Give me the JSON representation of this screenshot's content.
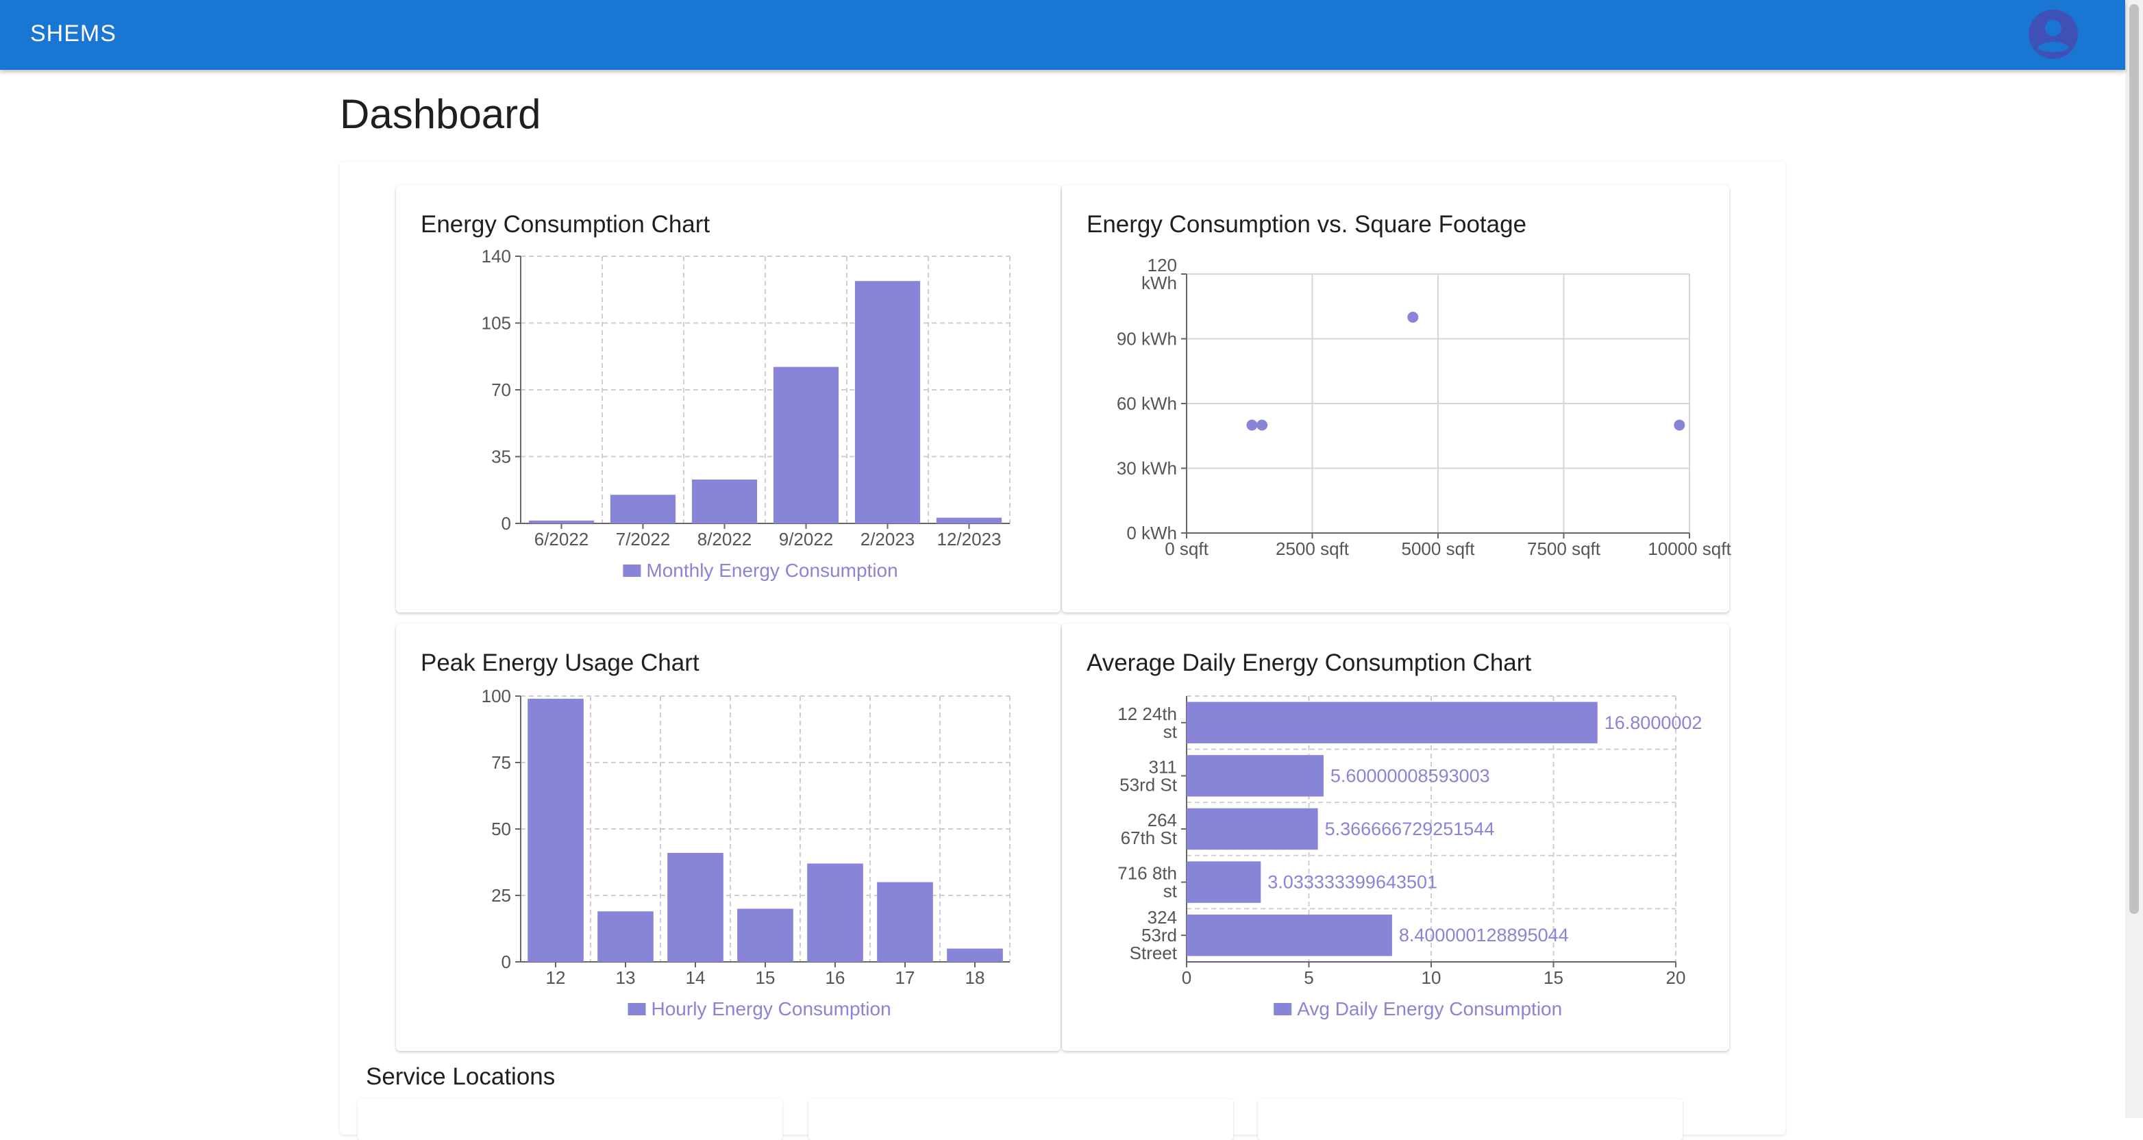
{
  "app": {
    "title": "SHEMS"
  },
  "page": {
    "title": "Dashboard"
  },
  "icons": {
    "account": "account-circle-icon"
  },
  "colors": {
    "appbar": "#1976d2",
    "series": "#8884d8"
  },
  "sections": {
    "service_locations": "Service Locations"
  },
  "charts": {
    "energy_consumption": {
      "title": "Energy Consumption Chart",
      "legend": "Monthly Energy Consumption"
    },
    "energy_vs_sqft": {
      "title": "Energy Consumption vs. Square Footage"
    },
    "peak_usage": {
      "title": "Peak Energy Usage Chart",
      "legend": "Hourly Energy Consumption"
    },
    "avg_daily": {
      "title": "Average Daily Energy Consumption Chart",
      "legend": "Avg Daily Energy Consumption"
    }
  },
  "chart_data": [
    {
      "id": "energy_consumption",
      "type": "bar",
      "categories": [
        "6/2022",
        "7/2022",
        "8/2022",
        "9/2022",
        "2/2023",
        "12/2023"
      ],
      "values": [
        1.5,
        15,
        23,
        82,
        127,
        3
      ],
      "ylim": [
        0,
        140
      ],
      "yticks": [
        0,
        35,
        70,
        105,
        140
      ],
      "series_name": "Monthly Energy Consumption",
      "grid": true,
      "legend_position": "bottom"
    },
    {
      "id": "energy_vs_sqft",
      "type": "scatter",
      "points": [
        {
          "x": 1300,
          "y": 50
        },
        {
          "x": 1500,
          "y": 50
        },
        {
          "x": 4500,
          "y": 100
        },
        {
          "x": 9800,
          "y": 50
        }
      ],
      "xlim": [
        0,
        10000
      ],
      "ylim": [
        0,
        120
      ],
      "xticks": [
        "0 sqft",
        "2500 sqft",
        "5000 sqft",
        "7500 sqft",
        "10000 sqft"
      ],
      "yticks": [
        "0 kWh",
        "30 kWh",
        "60 kWh",
        "90 kWh",
        "120 kWh"
      ],
      "grid": true
    },
    {
      "id": "peak_usage",
      "type": "bar",
      "categories": [
        "12",
        "13",
        "14",
        "15",
        "16",
        "17",
        "18"
      ],
      "values": [
        99,
        19,
        41,
        20,
        37,
        30,
        5
      ],
      "ylim": [
        0,
        100
      ],
      "yticks": [
        0,
        25,
        50,
        75,
        100
      ],
      "series_name": "Hourly Energy Consumption",
      "grid": true,
      "legend_position": "bottom"
    },
    {
      "id": "avg_daily",
      "type": "bar",
      "orientation": "horizontal",
      "categories": [
        "12 24th st",
        "311 53rd St",
        "264 67th St",
        "716 8th st",
        "324 53rd Street"
      ],
      "values": [
        16.8000002,
        5.60000008593003,
        5.366666729251544,
        3.033333399643501,
        8.400000128895044
      ],
      "value_labels": [
        "16.8000002",
        "5.60000008593003",
        "5.366666729251544",
        "3.033333399643501",
        "8.400000128895044"
      ],
      "xlim": [
        0,
        20
      ],
      "xticks": [
        0,
        5,
        10,
        15,
        20
      ],
      "series_name": "Avg Daily Energy Consumption",
      "grid": true,
      "legend_position": "bottom"
    }
  ]
}
